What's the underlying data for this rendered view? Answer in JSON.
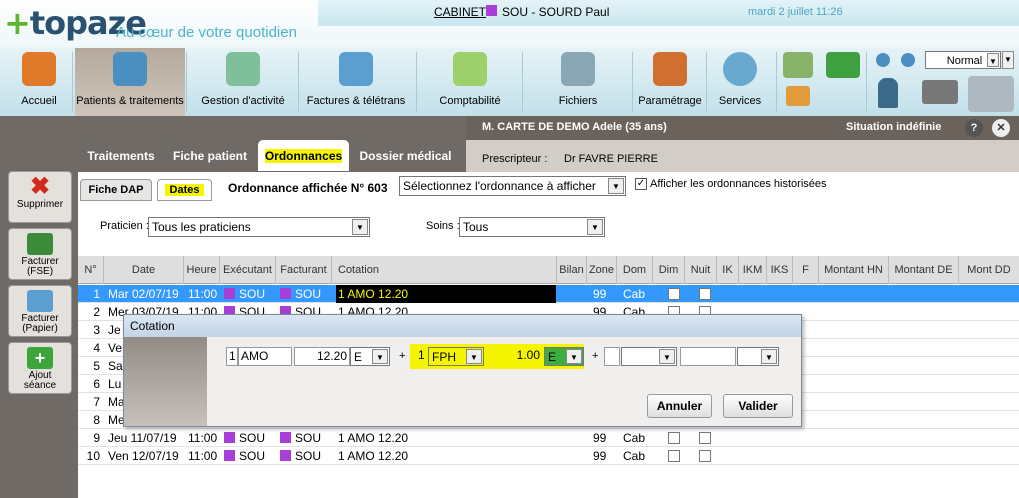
{
  "header": {
    "logo": "topaze",
    "slogan": "Au cœur de votre quotidien",
    "cabinet": "CABINET",
    "user": "SOU - SOURD Paul",
    "date": "mardi 2 juillet 11:26"
  },
  "toolbar": {
    "items": [
      "Accueil",
      "Patients & traitements",
      "Gestion d'activité",
      "Factures & télétrans",
      "Comptabilité",
      "Fichiers",
      "Paramétrage",
      "Services"
    ],
    "mode": "Normal"
  },
  "patient": {
    "name": "M. CARTE DE DEMO Adele (35 ans)",
    "situation": "Situation indéfinie",
    "prescripteur_label": "Prescripteur :",
    "prescripteur": "Dr FAVRE PIERRE"
  },
  "sidebar": {
    "items": [
      "Supprimer",
      "Facturer (FSE)",
      "Facturer (Papier)",
      "Ajout séance"
    ]
  },
  "tabs": [
    "Traitements",
    "Fiche patient",
    "Ordonnances",
    "Dossier médical"
  ],
  "subtabs": [
    "Fiche DAP",
    "Dates"
  ],
  "ordonnance": {
    "label": "Ordonnance affichée N° 603",
    "select": "Sélectionnez l'ordonnance à afficher",
    "hist": "Afficher les ordonnances historisées"
  },
  "filters": {
    "praticien_label": "Praticien :",
    "praticien": "Tous les praticiens",
    "soins_label": "Soins :",
    "soins": "Tous"
  },
  "table": {
    "headers": [
      "N°",
      "Date",
      "Heure",
      "Exécutant",
      "Facturant",
      "Cotation",
      "Bilan",
      "Zone",
      "Dom",
      "Dim",
      "Nuit",
      "IK",
      "IKM",
      "IKS",
      "F",
      "Montant HN",
      "Montant DE",
      "Mont DD"
    ],
    "rows": [
      {
        "n": "1",
        "date": "Mar 02/07/19",
        "heure": "11:00",
        "exec": "SOU",
        "fact": "SOU",
        "cot": "1 AMO 12.20",
        "zone": "99",
        "dom": "Cab"
      },
      {
        "n": "2",
        "date": "Mer 03/07/19",
        "heure": "11:00",
        "exec": "SOU",
        "fact": "SOU",
        "cot": "1 AMO 12.20",
        "zone": "99",
        "dom": "Cab"
      },
      {
        "n": "3",
        "date": "Je",
        "heure": "",
        "exec": "",
        "fact": "",
        "cot": "",
        "zone": "",
        "dom": ""
      },
      {
        "n": "4",
        "date": "Ve",
        "heure": "",
        "exec": "",
        "fact": "",
        "cot": "",
        "zone": "",
        "dom": ""
      },
      {
        "n": "5",
        "date": "Sam",
        "heure": "",
        "exec": "",
        "fact": "",
        "cot": "",
        "zone": "",
        "dom": ""
      },
      {
        "n": "6",
        "date": "Lu",
        "heure": "",
        "exec": "",
        "fact": "",
        "cot": "",
        "zone": "",
        "dom": ""
      },
      {
        "n": "7",
        "date": "Ma",
        "heure": "",
        "exec": "",
        "fact": "",
        "cot": "",
        "zone": "",
        "dom": ""
      },
      {
        "n": "8",
        "date": "Me",
        "heure": "",
        "exec": "",
        "fact": "",
        "cot": "",
        "zone": "",
        "dom": ""
      },
      {
        "n": "9",
        "date": "Jeu 11/07/19",
        "heure": "11:00",
        "exec": "SOU",
        "fact": "SOU",
        "cot": "1 AMO 12.20",
        "zone": "99",
        "dom": "Cab"
      },
      {
        "n": "10",
        "date": "Ven 12/07/19",
        "heure": "11:00",
        "exec": "SOU",
        "fact": "SOU",
        "cot": "1 AMO 12.20",
        "zone": "99",
        "dom": "Cab"
      }
    ]
  },
  "dialog": {
    "title": "Cotation",
    "f1": "1",
    "f2": "AMO",
    "f3": "12.20",
    "f4": "E",
    "plus1": "+",
    "f5": "1",
    "f6": "FPH",
    "f7": "1.00",
    "f8": "E",
    "plus2": "+",
    "cancel": "Annuler",
    "ok": "Valider"
  }
}
